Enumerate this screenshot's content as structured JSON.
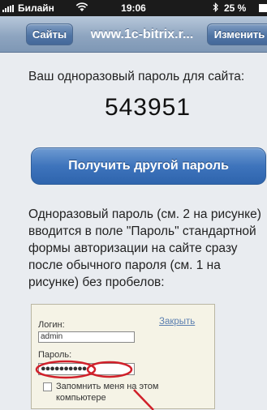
{
  "status_bar": {
    "carrier": "Билайн",
    "time": "19:06",
    "battery": "25 %"
  },
  "nav": {
    "back_label": "Сайты",
    "title": "www.1c-bitrix.r...",
    "edit_label": "Изменить"
  },
  "content": {
    "password_label": "Ваш одноразовый пароль для сайта:",
    "password_code": "543951",
    "get_other_button": "Получить другой пароль",
    "description": "Одноразовый пароль (см. 2 на рисунке) вводится в поле \"Пароль\" стандартной формы авторизации на сайте сразу после обычного пароля (см. 1 на рисунке) без пробелов:"
  },
  "figure": {
    "login_label": "Логин:",
    "login_value": "admin",
    "close_link": "Закрыть",
    "password_label": "Пароль:",
    "password_mask": "●●●●●●●●●●",
    "remember_label": "Запомнить меня на этом компьютере",
    "highlight_color": "#d0202a"
  },
  "icons": [
    "signal-icon",
    "wifi-icon",
    "bluetooth-icon",
    "battery-icon"
  ]
}
